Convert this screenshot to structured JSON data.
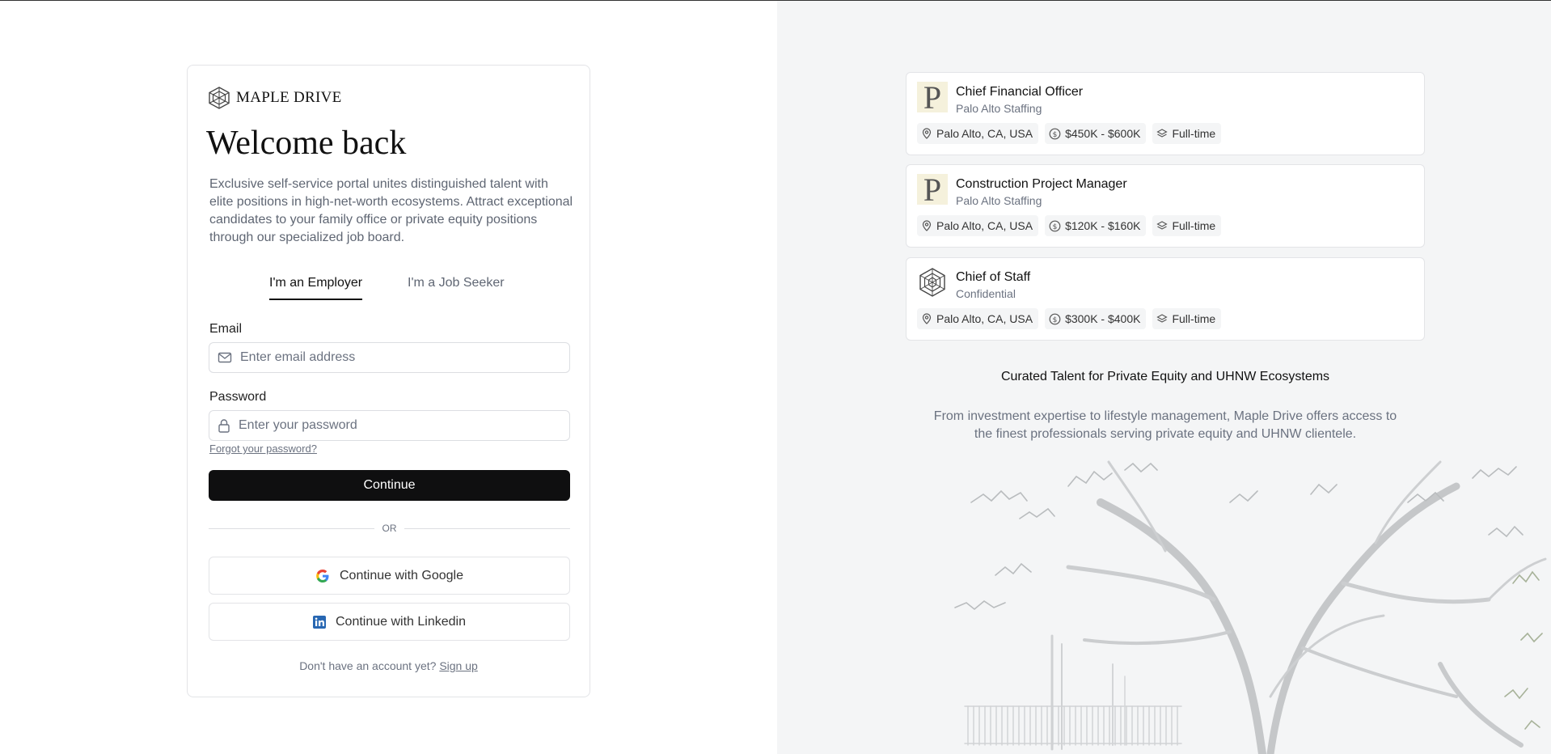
{
  "brand": {
    "name": "MAPLE DRIVE"
  },
  "login": {
    "title": "Welcome back",
    "description": "Exclusive self-service portal unites distinguished talent with elite positions in high-net-worth ecosystems. Attract exceptional candidates to your family office or private equity positions through our specialized job board.",
    "tabs": {
      "employer": "I'm an Employer",
      "job_seeker": "I'm a Job Seeker",
      "active": "employer"
    },
    "email_label": "Email",
    "email_placeholder": "Enter email address",
    "password_label": "Password",
    "password_placeholder": "Enter your password",
    "forgot_password": "Forgot your password?",
    "continue_label": "Continue",
    "or_label": "OR",
    "google_label": "Continue with Google",
    "linkedin_label": "Continue with Linkedin",
    "no_account": "Don't have an account yet?",
    "signup_link": "Sign up"
  },
  "jobs": [
    {
      "title": "Chief Financial Officer",
      "company": "Palo Alto Staffing",
      "logo": "P",
      "location": "Palo Alto, CA, USA",
      "salary": "$450K - $600K",
      "type": "Full-time"
    },
    {
      "title": "Construction Project Manager",
      "company": "Palo Alto Staffing",
      "logo": "P",
      "location": "Palo Alto, CA, USA",
      "salary": "$120K - $160K",
      "type": "Full-time"
    },
    {
      "title": "Chief of Staff",
      "company": "Confidential",
      "logo": "",
      "location": "Palo Alto, CA, USA",
      "salary": "$300K - $400K",
      "type": "Full-time"
    }
  ],
  "showcase": {
    "title": "Curated Talent for Private Equity and UHNW Ecosystems",
    "text": "From investment expertise to lifestyle management, Maple Drive offers access to the finest professionals serving private equity and UHNW clientele."
  },
  "icons": {
    "brand": "geometric-hexagon-logo-icon",
    "email": "mail-icon",
    "password": "lock-icon",
    "google": "google-g-icon",
    "linkedin": "linkedin-icon",
    "location": "map-pin-icon",
    "salary": "dollar-circle-icon",
    "type": "layers-icon"
  },
  "colors": {
    "primary_button": "#0f0f10",
    "right_bg": "#f4f5f6",
    "muted_text": "#6b7280",
    "logo_bg": "#f5f1dc"
  }
}
